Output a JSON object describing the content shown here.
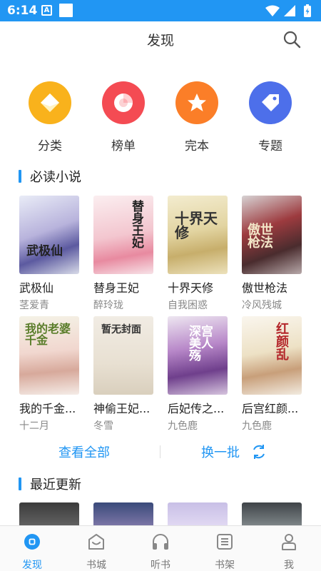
{
  "status_bar": {
    "time": "6:14",
    "notification_letter": "A"
  },
  "header": {
    "title": "发现"
  },
  "categories": [
    {
      "label": "分类",
      "color": "#f9b21c",
      "icon": "diamond-icon"
    },
    {
      "label": "榜单",
      "color": "#f44b53",
      "icon": "chart-ring-icon"
    },
    {
      "label": "完本",
      "color": "#fb7e28",
      "icon": "star-icon"
    },
    {
      "label": "专题",
      "color": "#4d6fea",
      "icon": "tag-icon"
    }
  ],
  "must_read": {
    "title": "必读小说",
    "books": [
      {
        "title": "武极仙",
        "author": "茎爱青",
        "cover_text": "武极仙"
      },
      {
        "title": "替身王妃",
        "author": "醉玲珑",
        "cover_text": "替身王妃"
      },
      {
        "title": "十界天修",
        "author": "自我困惑",
        "cover_text": "十界天修"
      },
      {
        "title": "傲世枪法",
        "author": "冷风残城",
        "cover_text": "傲世枪法"
      },
      {
        "title": "我的千金...",
        "author": "十二月",
        "cover_text": "我的老婆千金"
      },
      {
        "title": "神偷王妃...",
        "author": "冬雪",
        "cover_text": "暂无封面"
      },
      {
        "title": "后妃传之...",
        "author": "九色鹿",
        "cover_text": "深宫美人殇"
      },
      {
        "title": "后宫红颜...",
        "author": "九色鹿",
        "cover_text": "红颜乱"
      }
    ]
  },
  "actions": {
    "view_all": "查看全部",
    "refresh": "换一批"
  },
  "recent": {
    "title": "最近更新"
  },
  "bottom_nav": [
    {
      "label": "发现",
      "icon": "discover-icon",
      "active": true
    },
    {
      "label": "书城",
      "icon": "bookstore-icon",
      "active": false
    },
    {
      "label": "听书",
      "icon": "headphones-icon",
      "active": false
    },
    {
      "label": "书架",
      "icon": "bookshelf-icon",
      "active": false
    },
    {
      "label": "我",
      "icon": "profile-icon",
      "active": false
    }
  ],
  "colors": {
    "accent": "#2196f3",
    "status_bar": "#2196f3"
  }
}
